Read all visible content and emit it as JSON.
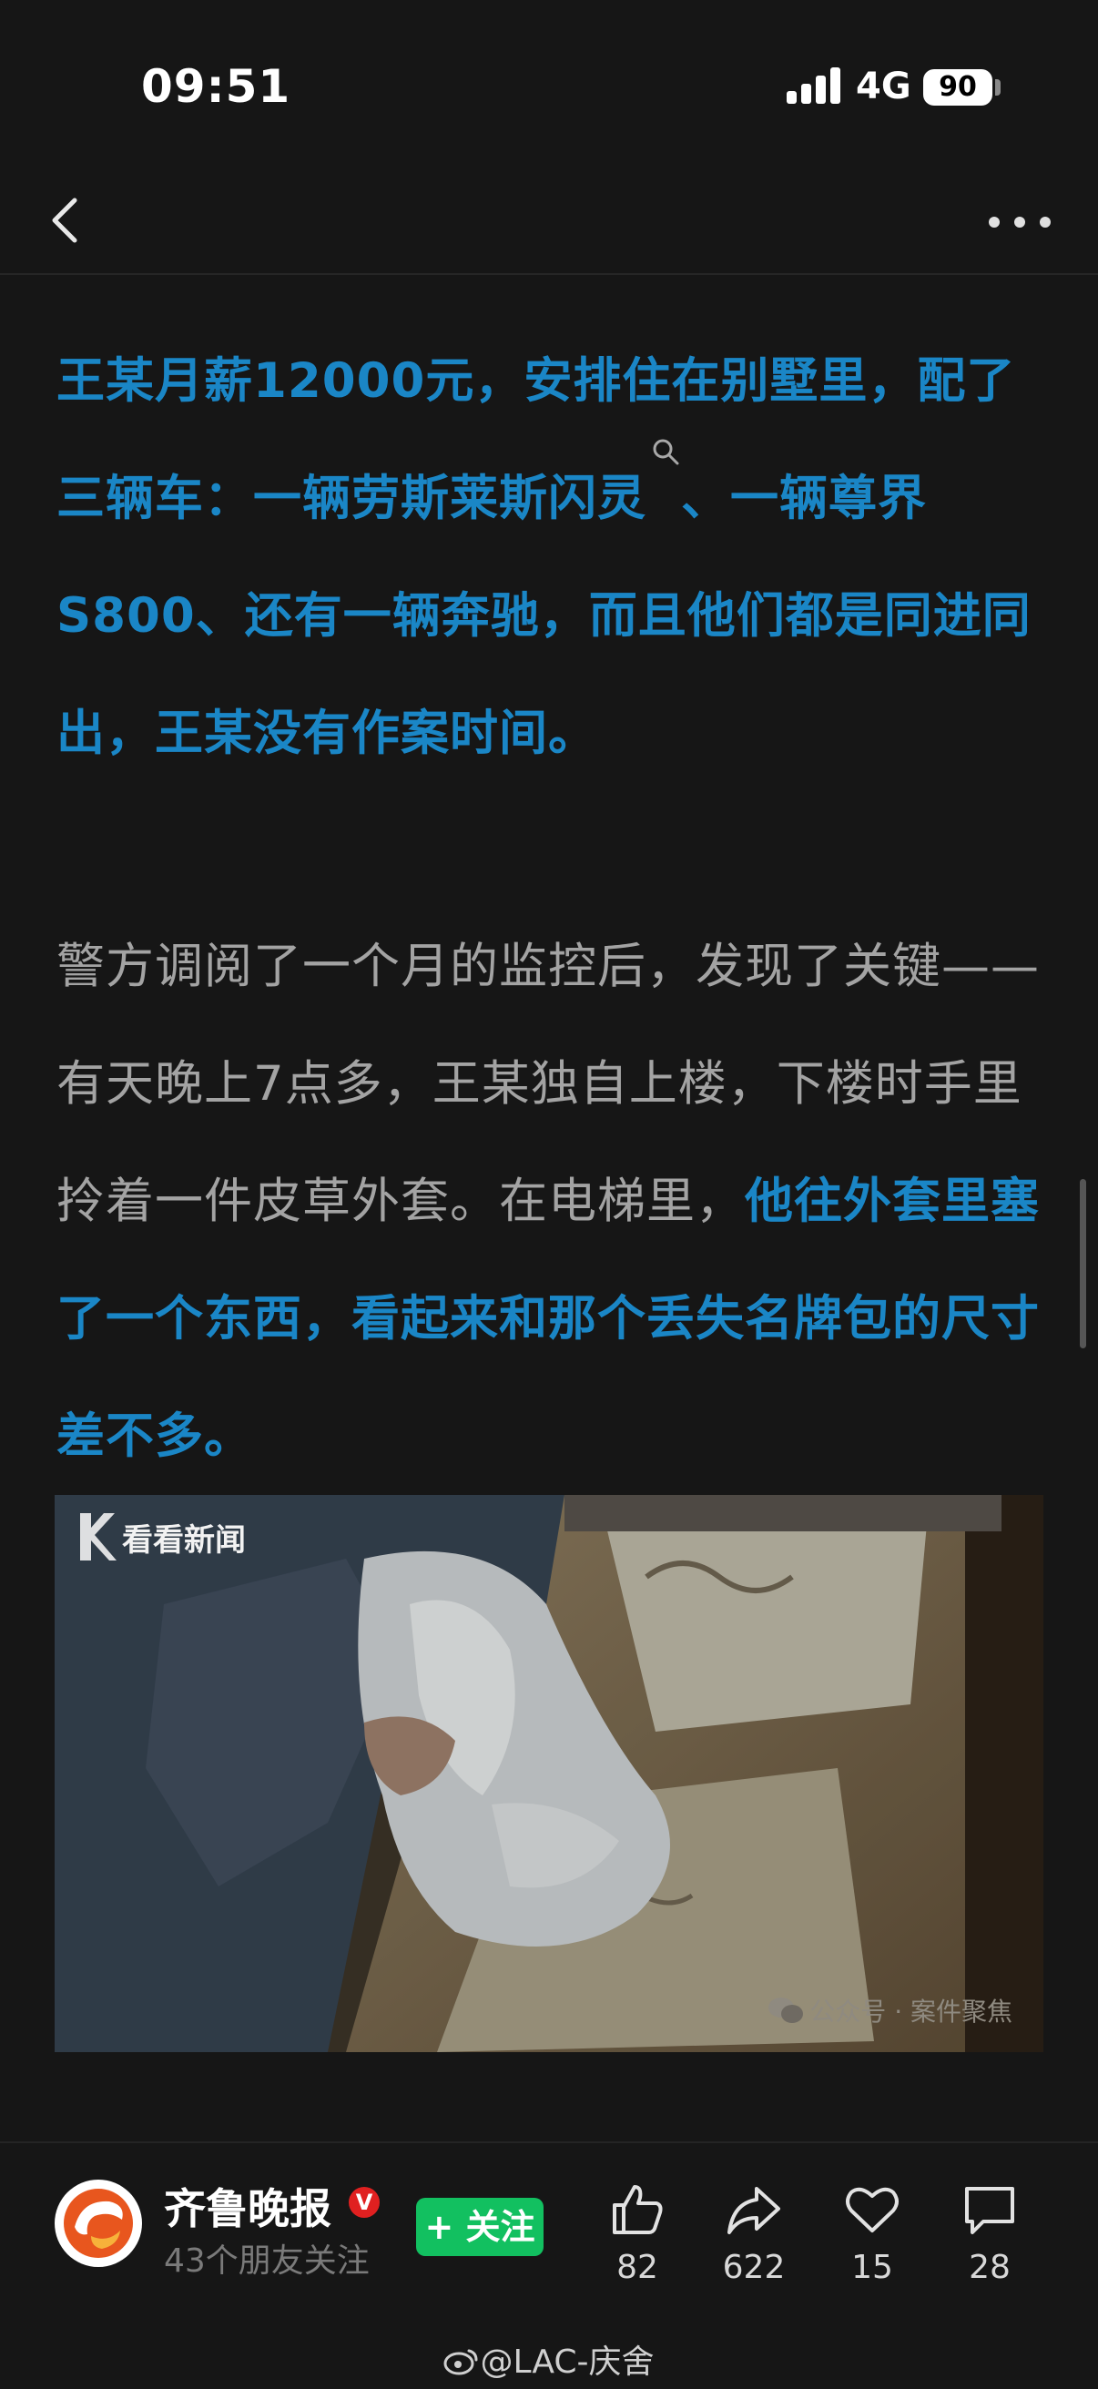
{
  "status_bar": {
    "time": "09:51",
    "network": "4G",
    "battery": "90"
  },
  "article": {
    "p1": "王某月薪12000元，安排住在别墅里，配了三辆车：一辆劳斯莱斯闪灵",
    "p1b": "、一辆尊界S800、还有一辆奔驰，而且他们都是同进同出，王某没有作案时间。",
    "p2_normal": "警方调阅了一个月的监控后，发现了关键——有天晚上7点多，王某独自上楼，下楼时手里拎着一件皮草外套。在电梯里，",
    "p2_highlight": "他往外套里塞了一个东西，看起来和那个丢失名牌包的尺寸差不多。",
    "image": {
      "logo_text": "看看新闻",
      "watermark": "公众号 · 案件聚焦"
    }
  },
  "footer": {
    "publisher": "齐鲁晚报",
    "verified_badge": "V",
    "followers": "43个朋友关注",
    "follow_label": "+ 关注",
    "like_count": "82",
    "share_count": "622",
    "favorite_count": "15",
    "comment_count": "28"
  },
  "watermark": "@LAC-庆舍",
  "colors": {
    "highlight": "#1a86c6",
    "follow": "#12c060",
    "background": "#161616"
  }
}
